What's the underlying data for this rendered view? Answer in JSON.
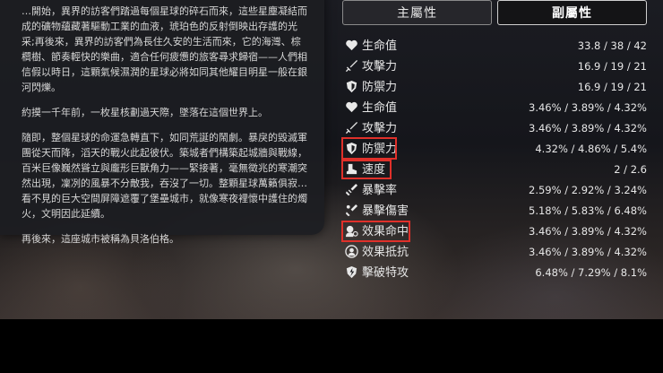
{
  "story": {
    "paragraphs": [
      "…開始，異界的訪客們踏過每個星球的碎石而來，這些星塵凝結而成的礦物蘊藏著驅動工業的血液，琥珀色的反射倒映出存護的光采;再後來，異界的訪客們為長住久安的生活而來，它的海灣、棕櫚樹、節奏輕快的樂曲，適合任何疲憊的旅客尋求歸宿——人們相信假以時日，這顆氣候濕潤的星球必將如同其他耀目明星一般在銀河閃爍。",
      "約摸一千年前，一枚星核劃過天際，墜落在這個世界上。",
      "隨即，整個星球的命運急轉直下，如同荒誕的鬧劇。暴戾的毀滅軍團從天而降，滔天的戰火此起彼伏。築城者們構築起城牆與戰線，百米巨像巍然聳立與龐形巨獸角力——緊接著，毫無徵兆的寒潮突然出現，凜冽的風暴不分敵我，吞沒了一切。整顆星球萬籟俱寂…看不見的巨大空間屏障遮覆了堡壘城市，就像寒夜裡懷中護住的燭火，文明因此延續。",
      "再後來，這座城市被稱為貝洛伯格。"
    ]
  },
  "tabs": {
    "main": "主屬性",
    "sub": "副屬性",
    "active": "sub"
  },
  "stats": [
    {
      "icon": "heart-icon",
      "name": "生命值",
      "value": "33.8 / 38 / 42"
    },
    {
      "icon": "sword-icon",
      "name": "攻擊力",
      "value": "16.9 / 19 / 21"
    },
    {
      "icon": "shield-icon",
      "name": "防禦力",
      "value": "16.9 / 19 / 21"
    },
    {
      "icon": "heart-icon",
      "name": "生命值",
      "value": "3.46% / 3.89% / 4.32%"
    },
    {
      "icon": "sword-icon",
      "name": "攻擊力",
      "value": "3.46% / 3.89% / 4.32%"
    },
    {
      "icon": "shield-icon",
      "name": "防禦力",
      "value": "4.32% / 4.86% / 5.4%"
    },
    {
      "icon": "boot-icon",
      "name": "速度",
      "value": "2 / 2.6"
    },
    {
      "icon": "crit-rate-icon",
      "name": "暴擊率",
      "value": "2.59% / 2.92% / 3.24%"
    },
    {
      "icon": "crit-damage-icon",
      "name": "暴擊傷害",
      "value": "5.18% / 5.83% / 6.48%"
    },
    {
      "icon": "effect-hit-icon",
      "name": "效果命中",
      "value": "3.46% / 3.89% / 4.32%"
    },
    {
      "icon": "effect-res-icon",
      "name": "效果抵抗",
      "value": "3.46% / 3.89% / 4.32%"
    },
    {
      "icon": "break-effect-icon",
      "name": "擊破特攻",
      "value": "6.48% / 7.29% / 8.1%"
    }
  ],
  "highlight_color": "#e0302a"
}
